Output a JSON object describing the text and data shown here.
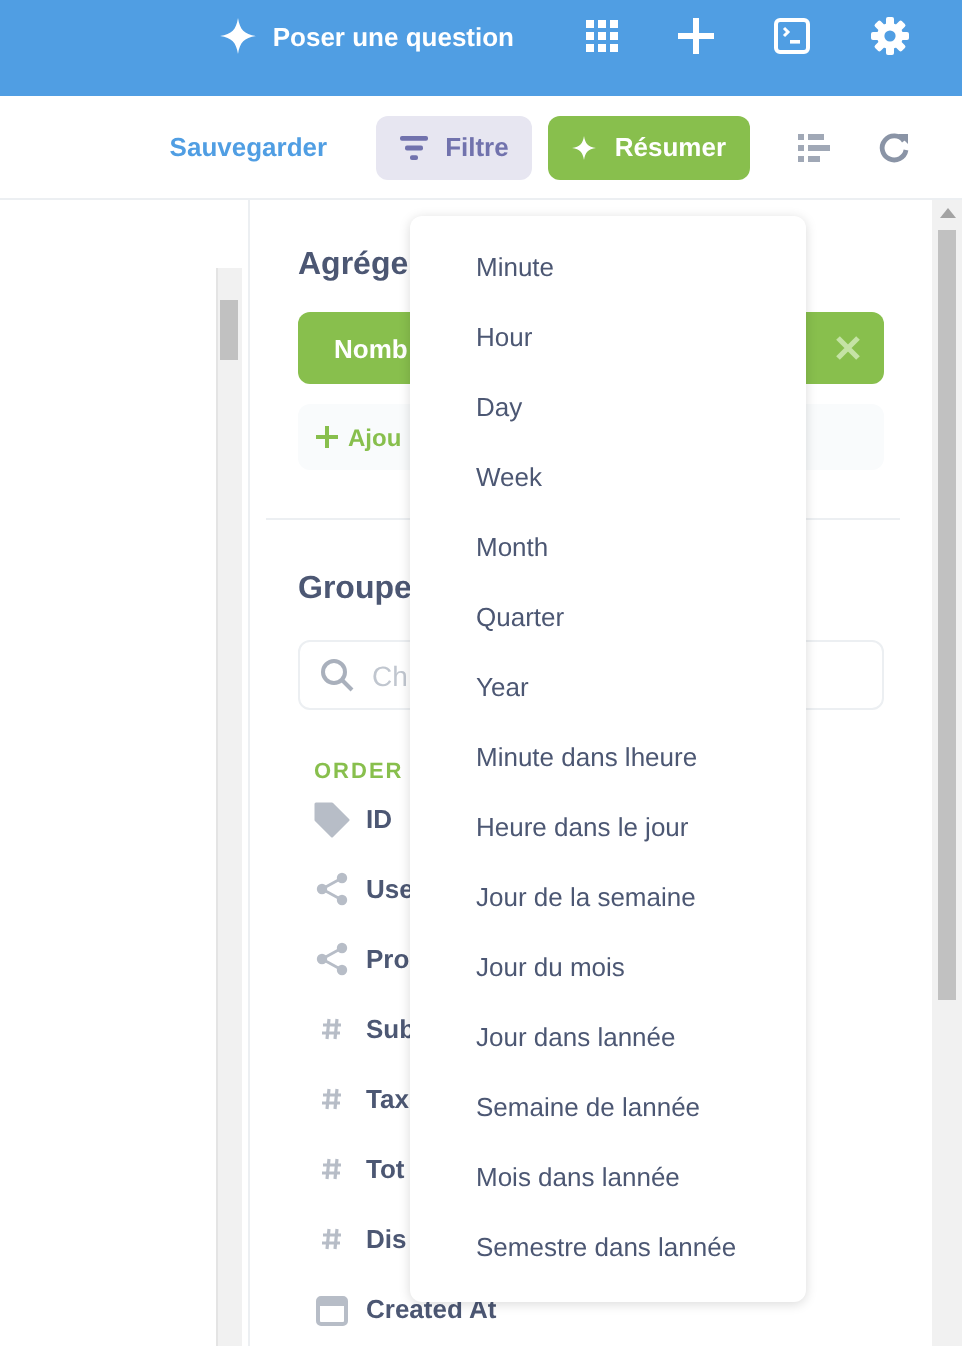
{
  "header": {
    "ask_label": "Poser une question"
  },
  "toolbar": {
    "save_label": "Sauvegarder",
    "filter_label": "Filtre",
    "summarize_label": "Résumer"
  },
  "sidebar": {
    "aggregate_title": "Agrége",
    "metric_label": "Nomb",
    "add_label": "Ajou",
    "group_title": "Groupe",
    "search": {
      "placeholder": "Ch"
    },
    "section_label": "ORDER",
    "fields": [
      {
        "kind": "tag",
        "label": "ID"
      },
      {
        "kind": "link",
        "label": "Use"
      },
      {
        "kind": "link",
        "label": "Pro"
      },
      {
        "kind": "number",
        "label": "Sub"
      },
      {
        "kind": "number",
        "label": "Tax"
      },
      {
        "kind": "number",
        "label": "Tot"
      },
      {
        "kind": "number",
        "label": "Dis"
      },
      {
        "kind": "date",
        "label": "Created At"
      }
    ]
  },
  "dropdown": {
    "items": [
      "Minute",
      "Hour",
      "Day",
      "Week",
      "Month",
      "Quarter",
      "Year",
      "Minute dans lheure",
      "Heure dans le jour",
      "Jour de la semaine",
      "Jour du mois",
      "Jour dans lannée",
      "Semaine de lannée",
      "Mois dans lannée",
      "Semestre dans lannée"
    ]
  }
}
